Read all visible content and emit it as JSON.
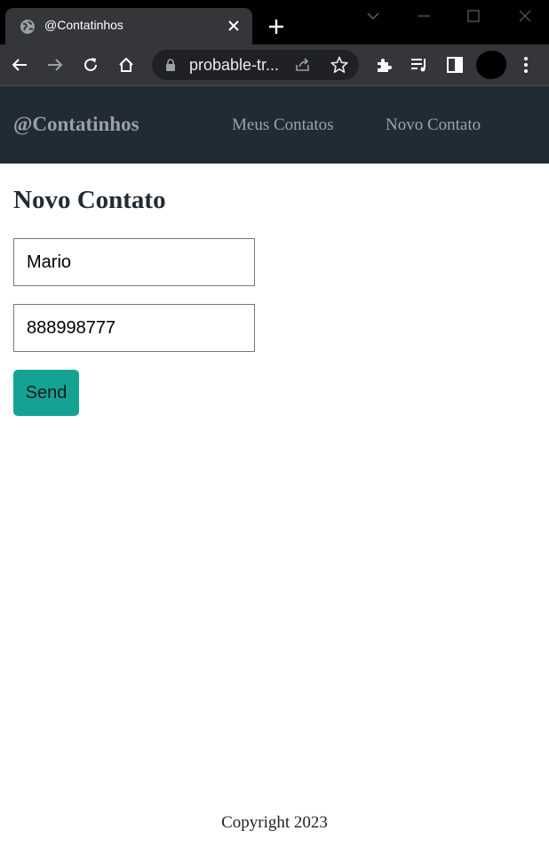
{
  "browser": {
    "tab_title": "@Contatinhos",
    "url": "probable-tr..."
  },
  "navbar": {
    "brand": "@Contatinhos",
    "links": [
      "Meus Contatos",
      "Novo Contato"
    ]
  },
  "main": {
    "heading": "Novo Contato",
    "name_value": "Mario",
    "phone_value": "888998777",
    "send_label": "Send"
  },
  "footer": {
    "text": "Copyright 2023"
  },
  "colors": {
    "navbar_bg": "#212b33",
    "button_bg": "#14a393"
  }
}
